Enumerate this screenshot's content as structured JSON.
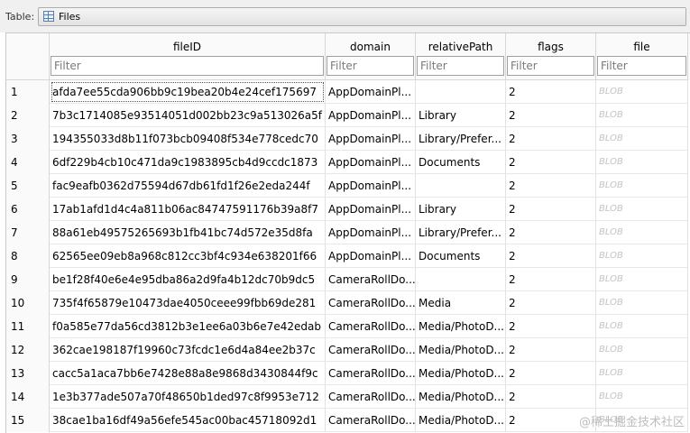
{
  "toolbar": {
    "table_label": "Table:",
    "table_value": "Files",
    "table_icon": "table-icon"
  },
  "grid": {
    "columns": [
      {
        "title": "fileID",
        "filter_placeholder": "Filter"
      },
      {
        "title": "domain",
        "filter_placeholder": "Filter"
      },
      {
        "title": "relativePath",
        "filter_placeholder": "Filter"
      },
      {
        "title": "flags",
        "filter_placeholder": "Filter"
      },
      {
        "title": "file",
        "filter_placeholder": "Filter"
      }
    ],
    "rows": [
      {
        "n": "1",
        "fileID": "afda7ee55cda906bb9c19bea20b4e24cef175697",
        "domain": "AppDomainPl...",
        "relativePath": "",
        "flags": "2",
        "file": "BLOB"
      },
      {
        "n": "2",
        "fileID": "7b3c1714085e93514051d002bb23c9a513026a5f",
        "domain": "AppDomainPl...",
        "relativePath": "Library",
        "flags": "2",
        "file": "BLOB"
      },
      {
        "n": "3",
        "fileID": "194355033d8b11f073bcb09408f534e778cedc70",
        "domain": "AppDomainPl...",
        "relativePath": "Library/Prefer...",
        "flags": "2",
        "file": "BLOB"
      },
      {
        "n": "4",
        "fileID": "6df229b4cb10c471da9c1983895cb4d9ccdc1873",
        "domain": "AppDomainPl...",
        "relativePath": "Documents",
        "flags": "2",
        "file": "BLOB"
      },
      {
        "n": "5",
        "fileID": "fac9eafb0362d75594d67db61fd1f26e2eda244f",
        "domain": "AppDomainPl...",
        "relativePath": "",
        "flags": "2",
        "file": "BLOB"
      },
      {
        "n": "6",
        "fileID": "17ab1afd1d4c4a811b06ac84747591176b39a8f7",
        "domain": "AppDomainPl...",
        "relativePath": "Library",
        "flags": "2",
        "file": "BLOB"
      },
      {
        "n": "7",
        "fileID": "88a61eb49575265693b1fb41bc74d572e35d8fa",
        "domain": "AppDomainPl...",
        "relativePath": "Library/Prefer...",
        "flags": "2",
        "file": "BLOB"
      },
      {
        "n": "8",
        "fileID": "62565ee09eb8a968c812cc3bf4c934e638201f66",
        "domain": "AppDomainPl...",
        "relativePath": "Documents",
        "flags": "2",
        "file": "BLOB"
      },
      {
        "n": "9",
        "fileID": "be1f28f40e6e4e95dba86a2d9fa4b12dc70b9dc5",
        "domain": "CameraRollDo...",
        "relativePath": "",
        "flags": "2",
        "file": "BLOB"
      },
      {
        "n": "10",
        "fileID": "735f4f65879e10473dae4050ceee99fbb69de281",
        "domain": "CameraRollDo...",
        "relativePath": "Media",
        "flags": "2",
        "file": "BLOB"
      },
      {
        "n": "11",
        "fileID": "f0a585e77da56cd3812b3e1ee6a03b6e7e42edab",
        "domain": "CameraRollDo...",
        "relativePath": "Media/PhotoD...",
        "flags": "2",
        "file": "BLOB"
      },
      {
        "n": "12",
        "fileID": "362cae198187f19960c73fcdc1e6d4a84ee2b37c",
        "domain": "CameraRollDo...",
        "relativePath": "Media/PhotoD...",
        "flags": "2",
        "file": "BLOB"
      },
      {
        "n": "13",
        "fileID": "cacc5a1aca7bb6e7428e88a8e9868d3430844f9c",
        "domain": "CameraRollDo...",
        "relativePath": "Media/PhotoD...",
        "flags": "2",
        "file": "BLOB"
      },
      {
        "n": "14",
        "fileID": "1e3b377ade507a70f48650b1ded97c8f9953e712",
        "domain": "CameraRollDo...",
        "relativePath": "Media/PhotoD...",
        "flags": "2",
        "file": "BLOB"
      },
      {
        "n": "15",
        "fileID": "38cae1ba16df49a56efe545ac00bac45718092d1",
        "domain": "CameraRollDo...",
        "relativePath": "Media/PhotoD...",
        "flags": "2",
        "file": "BLOB"
      }
    ]
  },
  "watermark": "@稀土掘金技术社区"
}
